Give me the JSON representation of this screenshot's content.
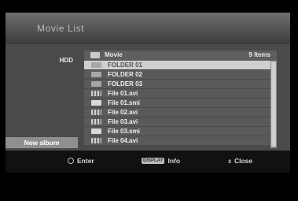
{
  "title": "Movie List",
  "left_panel": {
    "device": "HDD",
    "new_album": "New album"
  },
  "list": {
    "header": {
      "title": "Movie",
      "count": "9 Items",
      "icon": "folder-icon"
    },
    "items": [
      {
        "label": "FOLDER 01",
        "icon": "folder-icon",
        "selected": true
      },
      {
        "label": "FOLDER 02",
        "icon": "folder-icon",
        "selected": false
      },
      {
        "label": "FOLDER 03",
        "icon": "folder-icon",
        "selected": false
      },
      {
        "label": "File 01.avi",
        "icon": "movie-icon",
        "selected": false
      },
      {
        "label": "File 01.smi",
        "icon": "subtitle-icon",
        "selected": false
      },
      {
        "label": "File 02.avi",
        "icon": "movie-icon",
        "selected": false
      },
      {
        "label": "File 03.avi",
        "icon": "movie-icon",
        "selected": false
      },
      {
        "label": "File 03.smi",
        "icon": "subtitle-icon",
        "selected": false
      },
      {
        "label": "File 04.avi",
        "icon": "movie-icon",
        "selected": false
      }
    ]
  },
  "footer": {
    "enter": "Enter",
    "display": "DISPLAY",
    "info": "Info",
    "close": "Close"
  },
  "colors": {
    "selected_row": "#cfcfcf",
    "row": "#5a5a5a",
    "panel": "#4a4a4a"
  }
}
